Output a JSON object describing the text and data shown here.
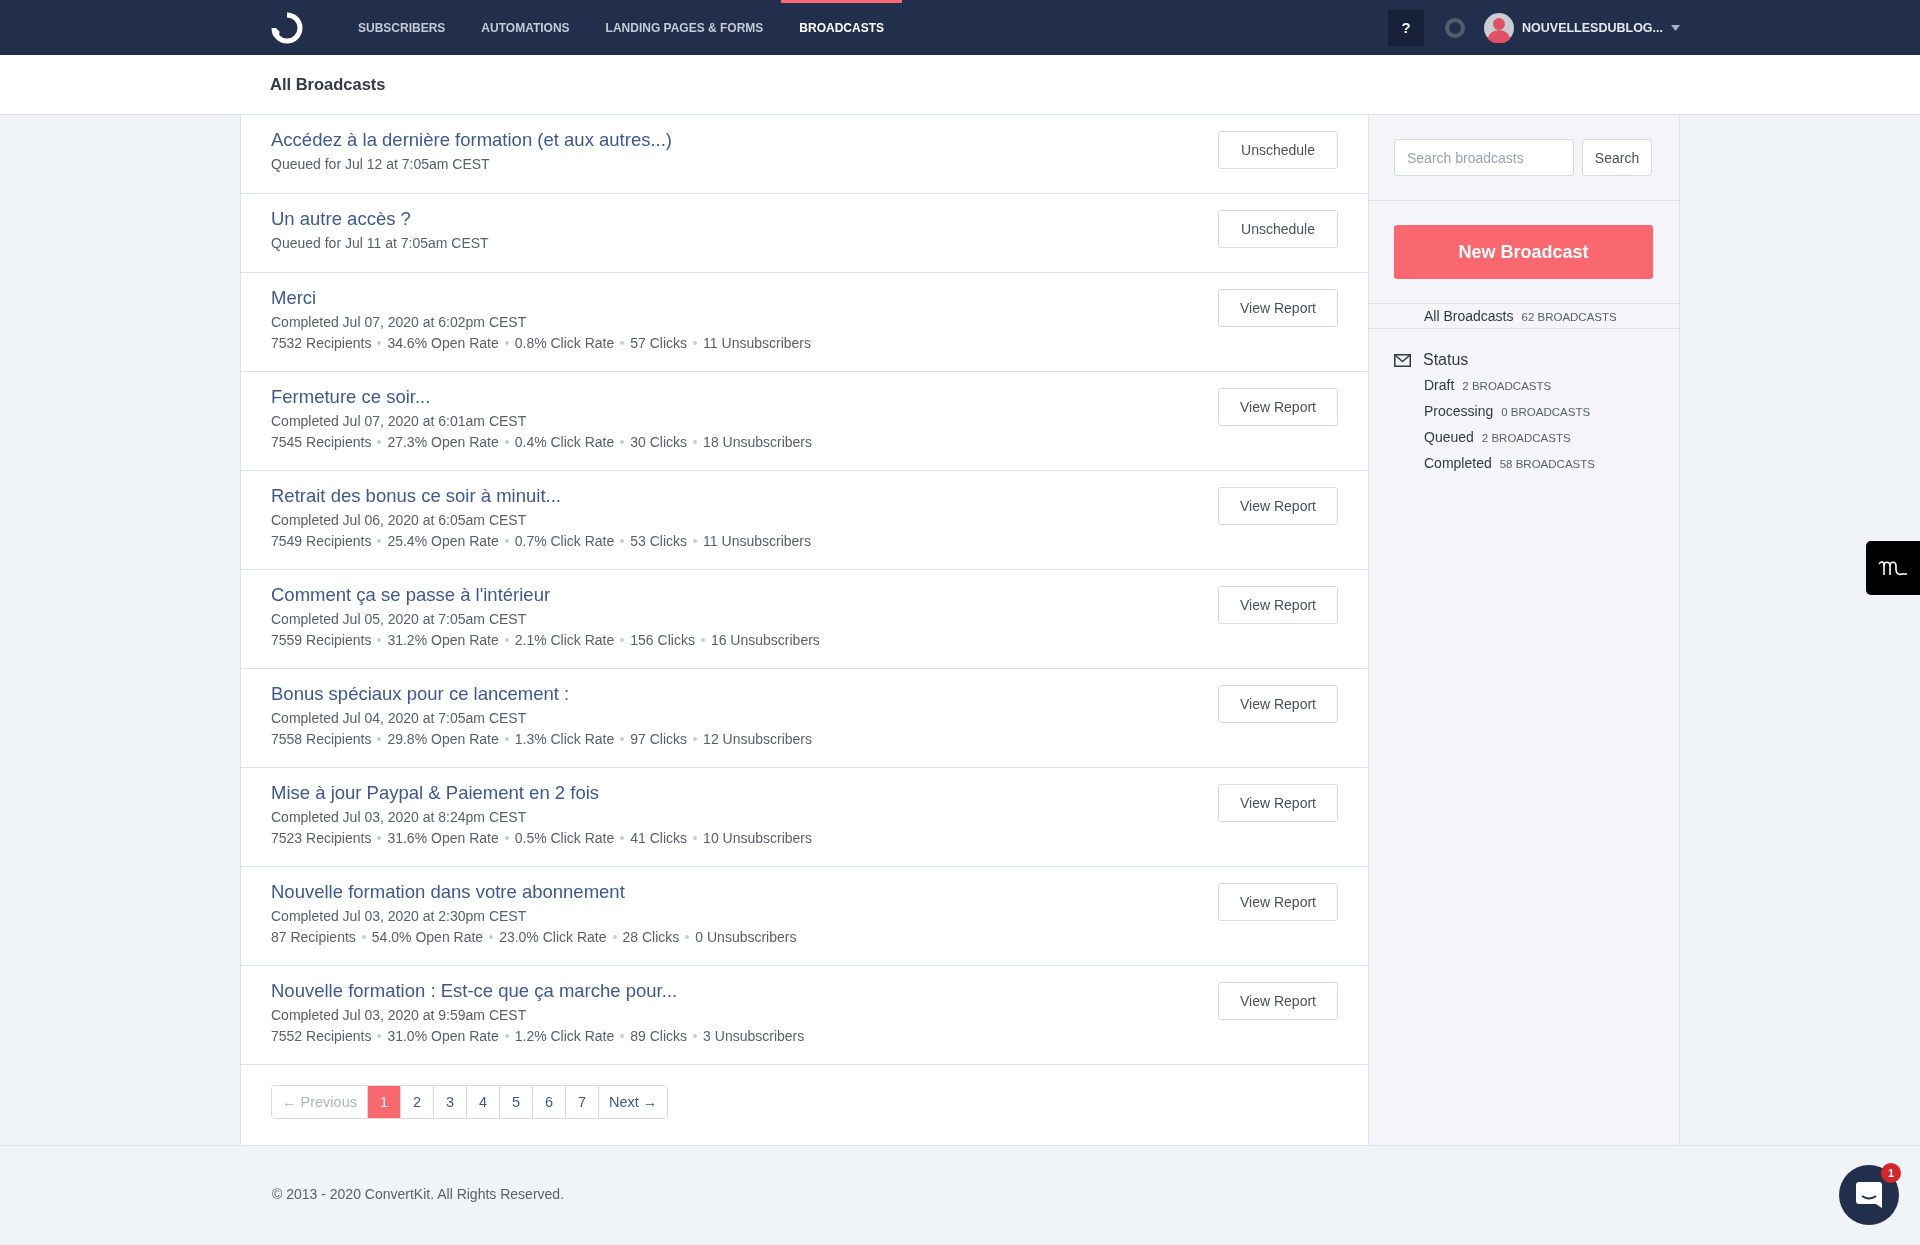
{
  "nav": {
    "items": [
      {
        "label": "SUBSCRIBERS",
        "selected": false
      },
      {
        "label": "AUTOMATIONS",
        "selected": false
      },
      {
        "label": "LANDING PAGES & FORMS",
        "selected": false
      },
      {
        "label": "BROADCASTS",
        "selected": true
      }
    ],
    "help": "?",
    "account": "NOUVELLESDUBLOG..."
  },
  "page_title": "All Broadcasts",
  "broadcasts": [
    {
      "title": "Accédez à la dernière formation (et aux autres...)",
      "status_line": "Queued for Jul 12 at 7:05am CEST",
      "action": "Unschedule"
    },
    {
      "title": "Un autre accès ?",
      "status_line": "Queued for Jul 11 at 7:05am CEST",
      "action": "Unschedule"
    },
    {
      "title": "Merci",
      "status_line": "Completed Jul 07, 2020 at 6:02pm CEST",
      "stats": [
        "7532 Recipients",
        "34.6% Open Rate",
        "0.8% Click Rate",
        "57 Clicks",
        "11 Unsubscribers"
      ],
      "action": "View Report"
    },
    {
      "title": "Fermeture ce soir...",
      "status_line": "Completed Jul 07, 2020 at 6:01am CEST",
      "stats": [
        "7545 Recipients",
        "27.3% Open Rate",
        "0.4% Click Rate",
        "30 Clicks",
        "18 Unsubscribers"
      ],
      "action": "View Report"
    },
    {
      "title": "Retrait des bonus ce soir à minuit...",
      "status_line": "Completed Jul 06, 2020 at 6:05am CEST",
      "stats": [
        "7549 Recipients",
        "25.4% Open Rate",
        "0.7% Click Rate",
        "53 Clicks",
        "11 Unsubscribers"
      ],
      "action": "View Report"
    },
    {
      "title": "Comment ça se passe à l'intérieur",
      "status_line": "Completed Jul 05, 2020 at 7:05am CEST",
      "stats": [
        "7559 Recipients",
        "31.2% Open Rate",
        "2.1% Click Rate",
        "156 Clicks",
        "16 Unsubscribers"
      ],
      "action": "View Report"
    },
    {
      "title": "Bonus spéciaux pour ce lancement :",
      "status_line": "Completed Jul 04, 2020 at 7:05am CEST",
      "stats": [
        "7558 Recipients",
        "29.8% Open Rate",
        "1.3% Click Rate",
        "97 Clicks",
        "12 Unsubscribers"
      ],
      "action": "View Report"
    },
    {
      "title": "Mise à jour Paypal & Paiement en 2 fois",
      "status_line": "Completed Jul 03, 2020 at 8:24pm CEST",
      "stats": [
        "7523 Recipients",
        "31.6% Open Rate",
        "0.5% Click Rate",
        "41 Clicks",
        "10 Unsubscribers"
      ],
      "action": "View Report"
    },
    {
      "title": "Nouvelle formation dans votre abonnement",
      "status_line": "Completed Jul 03, 2020 at 2:30pm CEST",
      "stats": [
        "87 Recipients",
        "54.0% Open Rate",
        "23.0% Click Rate",
        "28 Clicks",
        "0 Unsubscribers"
      ],
      "action": "View Report"
    },
    {
      "title": "Nouvelle formation : Est-ce que ça marche pour...",
      "status_line": "Completed Jul 03, 2020 at 9:59am CEST",
      "stats": [
        "7552 Recipients",
        "31.0% Open Rate",
        "1.2% Click Rate",
        "89 Clicks",
        "3 Unsubscribers"
      ],
      "action": "View Report"
    }
  ],
  "pagination": {
    "previous": {
      "label": "← Previous",
      "disabled": true
    },
    "pages": [
      {
        "label": "1",
        "selected": true
      },
      {
        "label": "2",
        "selected": false
      },
      {
        "label": "3",
        "selected": false
      },
      {
        "label": "4",
        "selected": false
      },
      {
        "label": "5",
        "selected": false
      },
      {
        "label": "6",
        "selected": false
      },
      {
        "label": "7",
        "selected": false
      }
    ],
    "next": {
      "label": "Next →",
      "disabled": false
    }
  },
  "sidebar": {
    "search": {
      "placeholder": "Search broadcasts",
      "button": "Search"
    },
    "new_button": "New Broadcast",
    "all": {
      "label": "All Broadcasts",
      "count": "62 BROADCASTS"
    },
    "status": {
      "heading": "Status",
      "items": [
        {
          "label": "Draft",
          "count": "2 BROADCASTS"
        },
        {
          "label": "Processing",
          "count": "0 BROADCASTS"
        },
        {
          "label": "Queued",
          "count": "2 BROADCASTS"
        },
        {
          "label": "Completed",
          "count": "58 BROADCASTS"
        }
      ]
    }
  },
  "footer": "© 2013 - 2020 ConvertKit. All Rights Reserved.",
  "chat": {
    "badge": "1"
  }
}
